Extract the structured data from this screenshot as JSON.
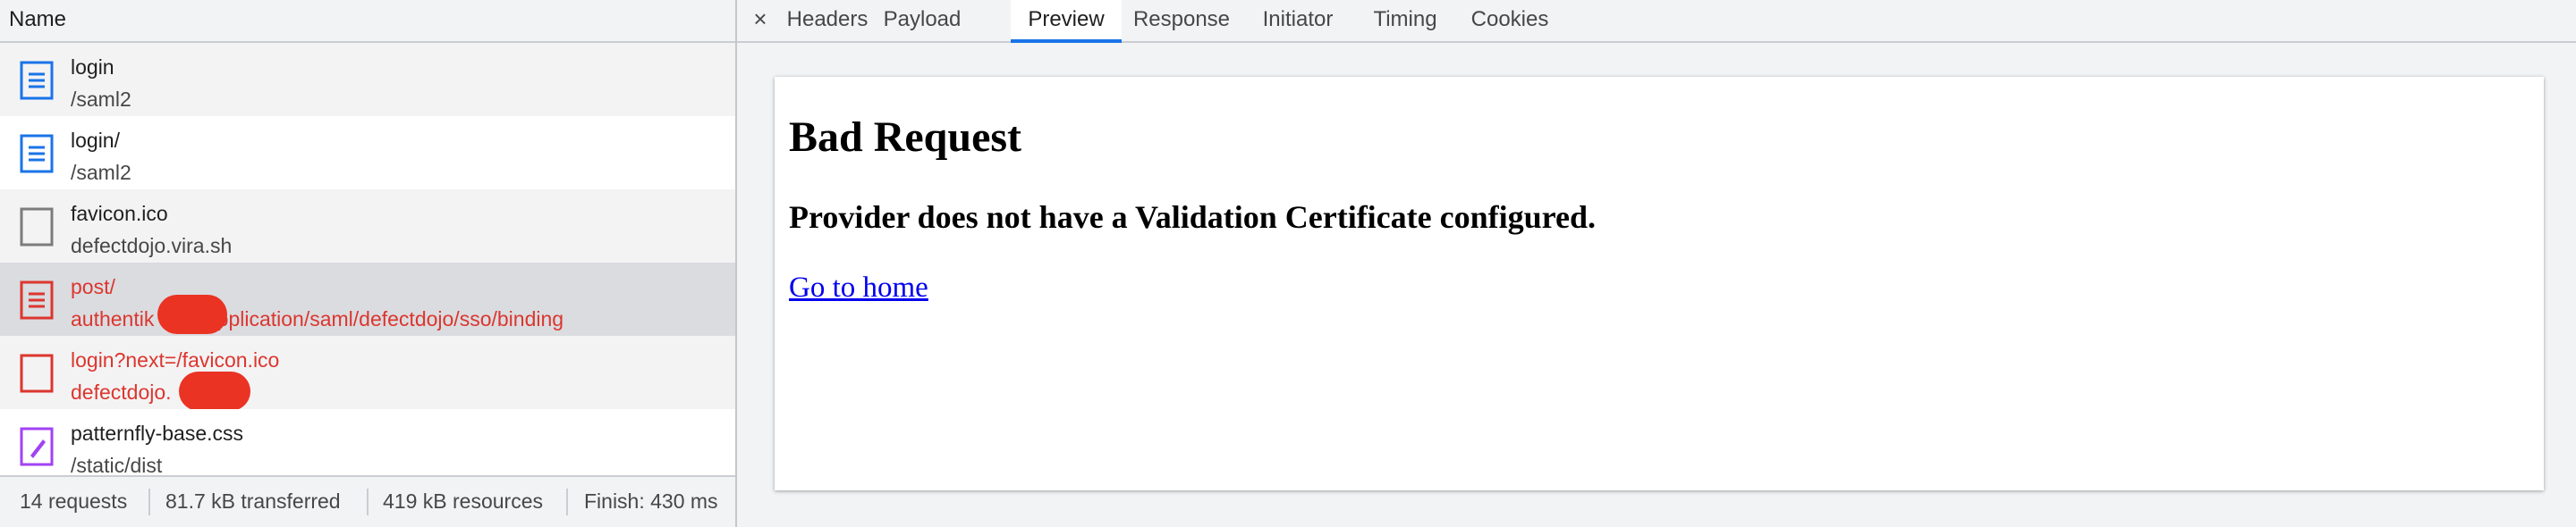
{
  "request_list": {
    "column_header": "Name",
    "requests": [
      {
        "name": "login",
        "path": "/saml2",
        "type": "document-icon"
      },
      {
        "name": "login/",
        "path": "/saml2",
        "type": "document-icon"
      },
      {
        "name": "favicon.ico",
        "path": "defectdojo.vira.sh",
        "type": "file-icon"
      },
      {
        "name": "post/",
        "path": "authentik        /application/saml/defectdojo/sso/binding",
        "type": "document-error-icon",
        "status": "error"
      },
      {
        "name": "login?next=/favicon.ico",
        "path": "defectdojo.",
        "type": "file-error-icon",
        "status": "error"
      },
      {
        "name": "patternfly-base.css",
        "path": "/static/dist",
        "type": "stylesheet-icon"
      }
    ]
  },
  "status_bar": {
    "requests": "14 requests",
    "transferred": "81.7 kB transferred",
    "resources": "419 kB resources",
    "finish": "Finish: 430 ms"
  },
  "detail_tabs": {
    "close_label": "×",
    "tabs": [
      "Headers",
      "Payload",
      "Preview",
      "Response",
      "Initiator",
      "Timing",
      "Cookies"
    ],
    "active_tab": "Preview"
  },
  "preview": {
    "title": "Bad Request",
    "message": "Provider does not have a Validation Certificate configured.",
    "link_text": "Go to home"
  },
  "colors": {
    "error_red": "#dc362e",
    "redaction_red": "#ea3323",
    "document_blue": "#1a73e8",
    "stylesheet_purple": "#a142f4",
    "active_tab_underline": "#1a73e8",
    "link_blue": "#0000ee"
  }
}
